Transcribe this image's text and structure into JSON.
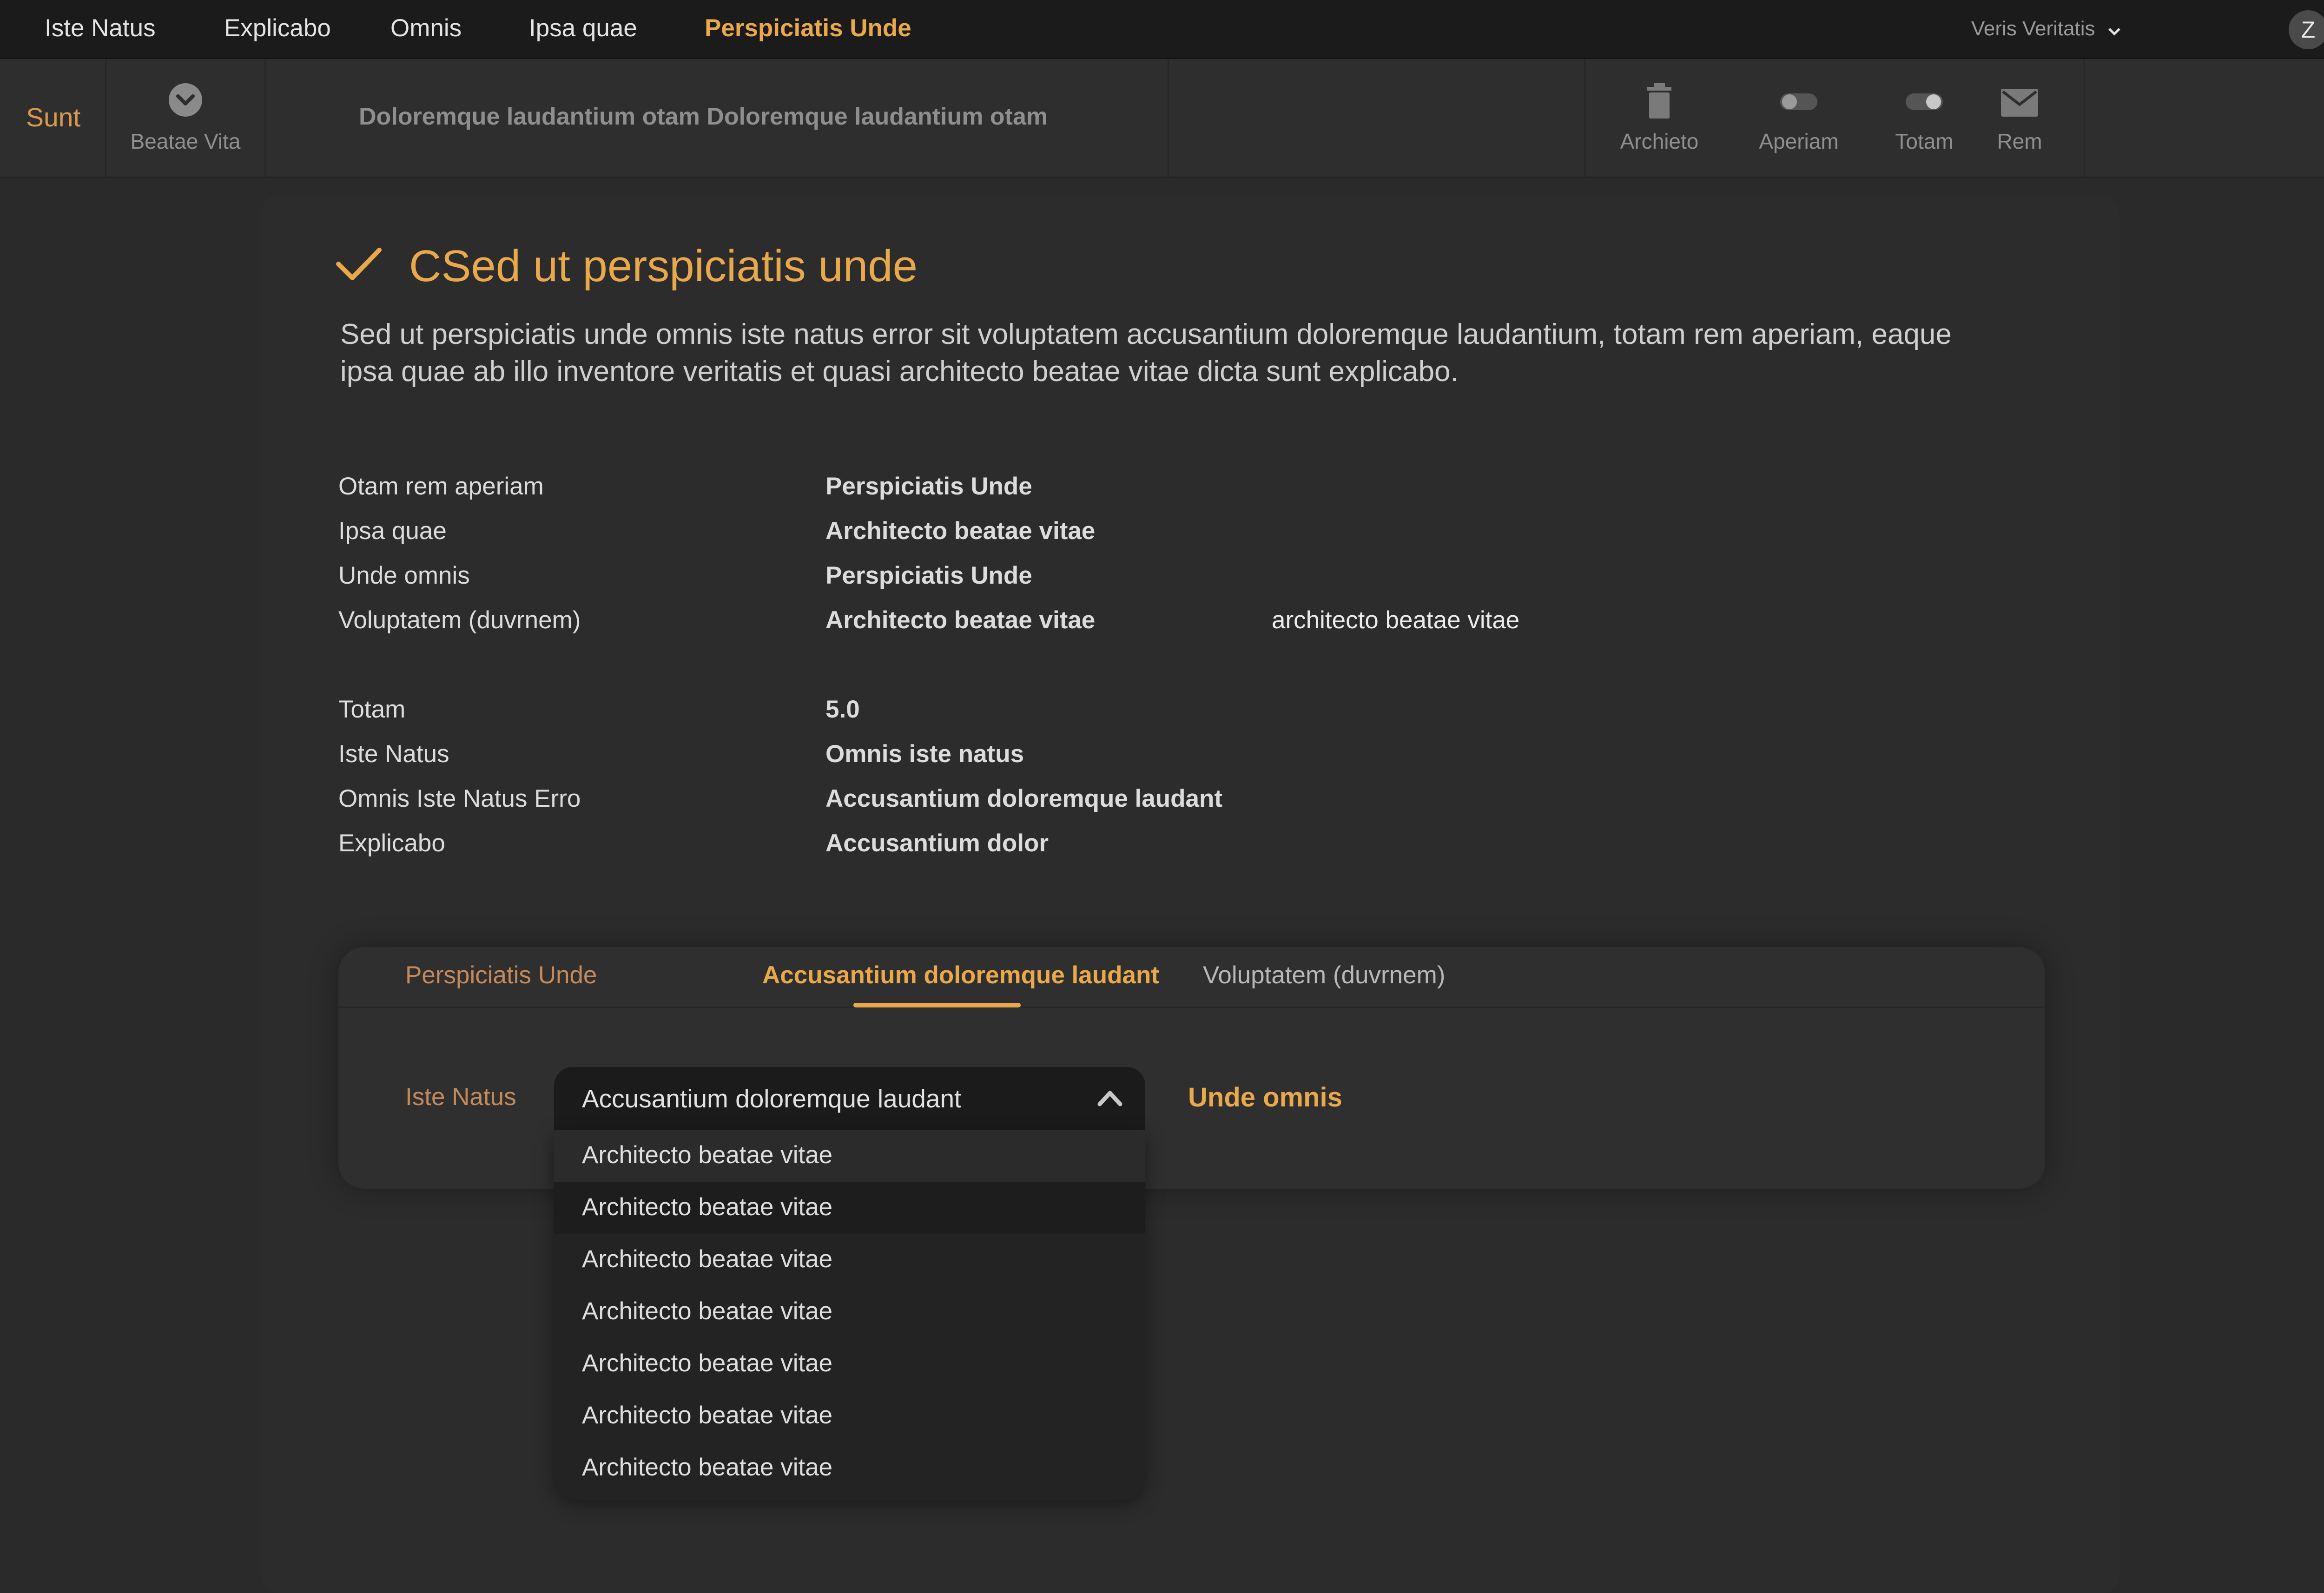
{
  "top_nav": {
    "items": [
      {
        "label": "Iste Natus",
        "active": false
      },
      {
        "label": "Explicabo",
        "active": false
      },
      {
        "label": "Omnis",
        "active": false
      },
      {
        "label": "Ipsa quae",
        "active": false
      },
      {
        "label": "Perspiciatis Unde",
        "active": true
      }
    ],
    "user_menu": "Veris Veritatis",
    "avatar_initial": "Z"
  },
  "toolbar": {
    "left_label": "Sunt",
    "dropdown_button": {
      "label": "Beatae Vita",
      "icon": "chevron-circle-icon"
    },
    "description": "Doloremque laudantium otam Doloremque laudantium otam",
    "actions": [
      {
        "label": "Archieto",
        "icon": "trash-icon"
      },
      {
        "label": "Aperiam",
        "icon": "toggle-off-icon"
      },
      {
        "label": "Totam",
        "icon": "toggle-on-icon"
      },
      {
        "label": "Rem",
        "icon": "mail-icon"
      }
    ]
  },
  "page": {
    "title": "CSed ut perspiciatis unde",
    "intro": "Sed ut perspiciatis unde omnis iste natus error sit voluptatem accusantium doloremque laudantium, totam rem aperiam, eaque ipsa quae ab illo inventore veritatis et quasi architecto beatae vitae dicta sunt explicabo."
  },
  "properties_group1": [
    {
      "label": "Otam rem aperiam",
      "value": "Perspiciatis Unde"
    },
    {
      "label": "Ipsa quae",
      "value": "Architecto beatae vitae"
    },
    {
      "label": "Unde omnis",
      "value": "Perspiciatis Unde"
    },
    {
      "label": "Voluptatem (duvrnem)",
      "value": "Architecto beatae vitae",
      "extra": "architecto beatae vitae"
    }
  ],
  "properties_group2": [
    {
      "label": "Totam",
      "value": "5.0"
    },
    {
      "label": "Iste Natus",
      "value": "Omnis iste natus"
    },
    {
      "label": "Omnis Iste Natus Erro",
      "value": "Accusantium doloremque laudant"
    },
    {
      "label": "Explicabo",
      "value": "Accusantium dolor"
    }
  ],
  "card": {
    "tabs": [
      {
        "label": "Perspiciatis Unde"
      },
      {
        "label": "Accusantium doloremque laudant",
        "active": true
      },
      {
        "label": "Voluptatem (duvrnem)"
      }
    ],
    "field_label": "Iste Natus",
    "select_value": "Accusantium doloremque laudant",
    "side_link": "Unde omnis",
    "options": [
      "Architecto beatae vitae",
      "Architecto beatae vitae",
      "Architecto beatae vitae",
      "Architecto beatae vitae",
      "Architecto beatae vitae",
      "Architecto beatae vitae",
      "Architecto beatae vitae"
    ]
  },
  "colors": {
    "accent": "#e9a84b",
    "background": "#2a2a2a",
    "topbar": "#1b1b1b"
  }
}
